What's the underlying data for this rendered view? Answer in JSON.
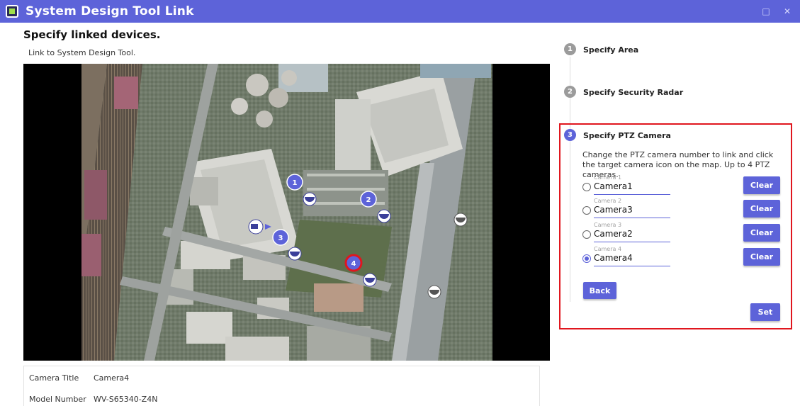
{
  "window": {
    "title": "System Design Tool Link",
    "logo_icon": "app-logo-icon",
    "maximize_glyph": "□",
    "close_glyph": "✕"
  },
  "page": {
    "heading": "Specify linked devices.",
    "subheading": "Link to System Design Tool."
  },
  "map": {
    "pins": [
      {
        "number": "1"
      },
      {
        "number": "2"
      },
      {
        "number": "3"
      },
      {
        "number": "4",
        "selected": true
      }
    ],
    "camera_icons": [
      "camera-icon",
      "camera-icon",
      "camera-icon",
      "camera-icon",
      "camera-icon",
      "camera-icon",
      "camera-icon",
      "camera-icon"
    ]
  },
  "info": {
    "camera_title_label": "Camera Title",
    "camera_title_value": "Camera4",
    "model_number_label": "Model Number",
    "model_number_value": "WV-S65340-Z4N"
  },
  "steps": [
    {
      "number": "1",
      "label": "Specify Area"
    },
    {
      "number": "2",
      "label": "Specify Security Radar"
    },
    {
      "number": "3",
      "label": "Specify PTZ Camera"
    }
  ],
  "ptz": {
    "description": "Change the PTZ camera number to link and click the target camera icon on the map. Up to 4 PTZ cameras.",
    "cameras": [
      {
        "label": "Camera 1",
        "value": "Camera1",
        "clear_label": "Clear",
        "checked": false
      },
      {
        "label": "Camera 2",
        "value": "Camera3",
        "clear_label": "Clear",
        "checked": false
      },
      {
        "label": "Camera 3",
        "value": "Camera2",
        "clear_label": "Clear",
        "checked": false
      },
      {
        "label": "Camera 4",
        "value": "Camera4",
        "clear_label": "Clear",
        "checked": true
      }
    ],
    "back_label": "Back",
    "set_label": "Set"
  },
  "colors": {
    "accent": "#5d63d9",
    "highlight": "#e0161e",
    "inactive_step": "#9b9b9b"
  }
}
